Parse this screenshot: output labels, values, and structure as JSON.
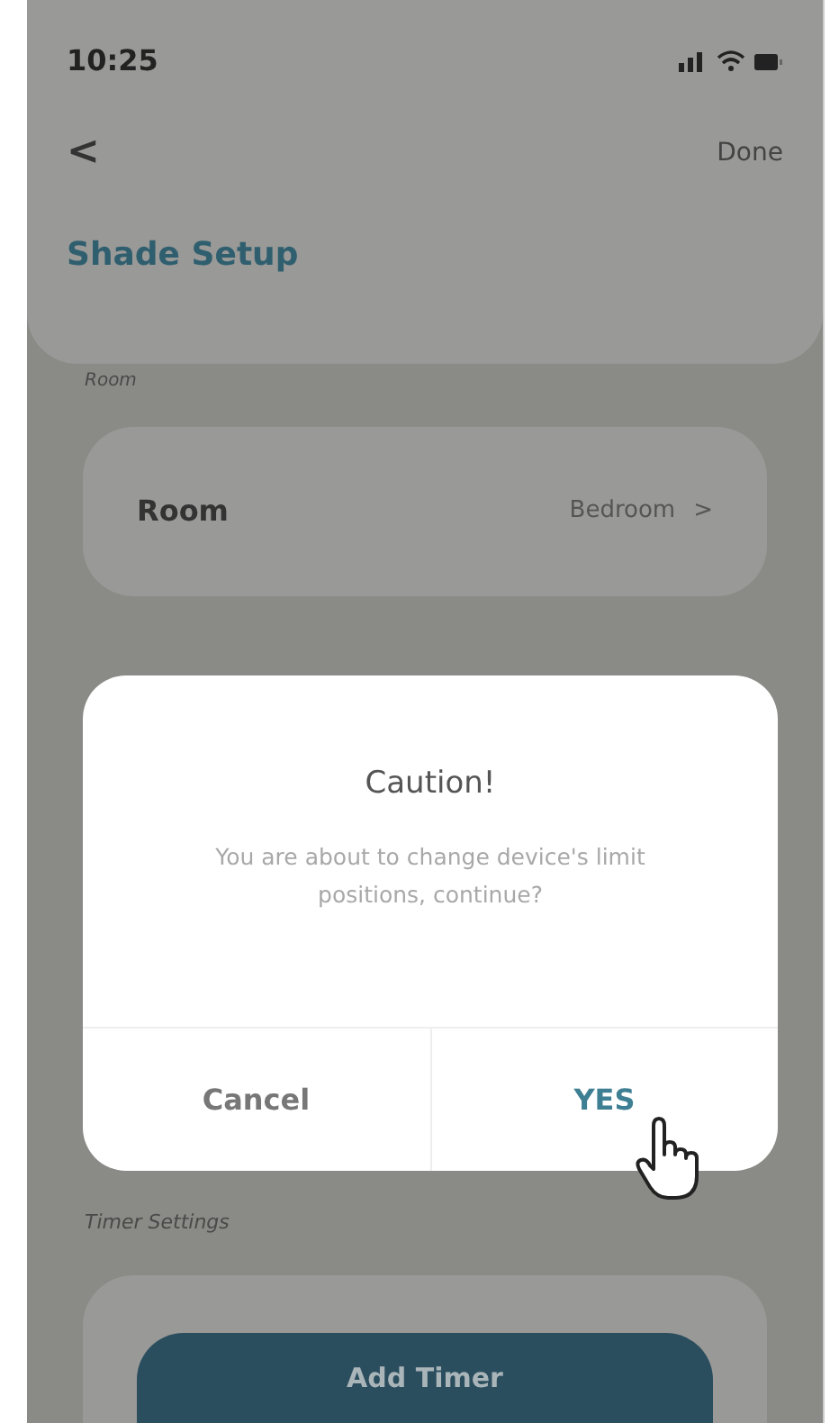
{
  "status_bar": {
    "time": "10:25"
  },
  "nav": {
    "back": "<",
    "done": "Done",
    "title": "Shade Setup"
  },
  "sections": [
    {
      "label": "Room",
      "rows": [
        {
          "label": "Room",
          "value": "Bedroom",
          "chevron": ">"
        }
      ]
    },
    {
      "label": "Timer Settings",
      "button": "Add Timer"
    }
  ],
  "dialog": {
    "title": "Caution!",
    "message": "You are about to change device's limit positions, continue?",
    "buttons": [
      {
        "label": "Cancel",
        "kind": "secondary"
      },
      {
        "label": "YES",
        "kind": "primary"
      }
    ]
  }
}
